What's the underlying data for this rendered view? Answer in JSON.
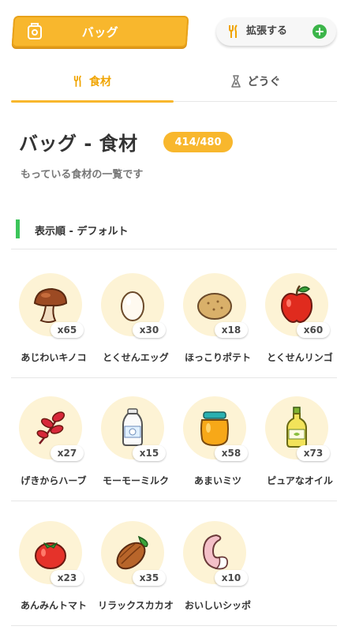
{
  "header": {
    "bag_button_label": "バッグ",
    "expand_button_label": "拡張する"
  },
  "tabs": [
    {
      "label": "食材",
      "active": true
    },
    {
      "label": "どうぐ",
      "active": false
    }
  ],
  "page": {
    "title": "バッグ - 食材",
    "count": "414/480",
    "subtitle": "もっている食材の一覧です",
    "sort_label": "表示順 - デフォルト"
  },
  "colors": {
    "accent": "#f8b72d",
    "sort_marker": "#3cc55a",
    "add_button": "#3cb54a",
    "item_circle": "#fdf3d5"
  },
  "items": [
    {
      "name": "あじわいキノコ",
      "qty": "x65",
      "icon": "mushroom-icon"
    },
    {
      "name": "とくせんエッグ",
      "qty": "x30",
      "icon": "egg-icon"
    },
    {
      "name": "ほっこりポテト",
      "qty": "x18",
      "icon": "potato-icon"
    },
    {
      "name": "とくせんリンゴ",
      "qty": "x60",
      "icon": "apple-icon"
    },
    {
      "name": "げきからハーブ",
      "qty": "x27",
      "icon": "herb-icon"
    },
    {
      "name": "モーモーミルク",
      "qty": "x15",
      "icon": "milk-icon"
    },
    {
      "name": "あまいミツ",
      "qty": "x58",
      "icon": "honey-icon"
    },
    {
      "name": "ピュアなオイル",
      "qty": "x73",
      "icon": "oil-icon"
    },
    {
      "name": "あんみんトマト",
      "qty": "x23",
      "icon": "tomato-icon"
    },
    {
      "name": "リラックスカカオ",
      "qty": "x35",
      "icon": "cacao-icon"
    },
    {
      "name": "おいしいシッポ",
      "qty": "x10",
      "icon": "tail-icon"
    }
  ]
}
